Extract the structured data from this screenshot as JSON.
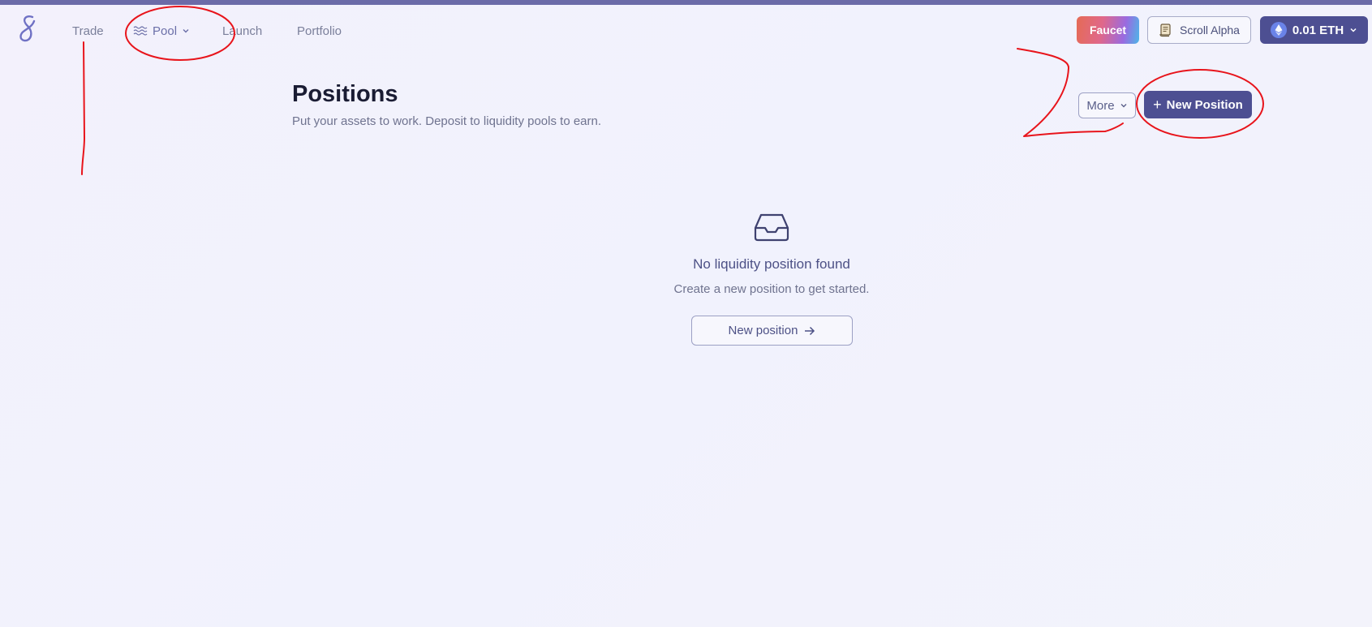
{
  "nav": {
    "items": [
      {
        "label": "Trade"
      },
      {
        "label": "Pool"
      },
      {
        "label": "Launch"
      },
      {
        "label": "Portfolio"
      }
    ]
  },
  "header": {
    "faucet_label": "Faucet",
    "network_label": "Scroll Alpha",
    "wallet_label": "0.01 ETH"
  },
  "page": {
    "title": "Positions",
    "subtitle": "Put your assets to work. Deposit to liquidity pools to earn.",
    "more_label": "More",
    "new_position_label": "New Position"
  },
  "empty_state": {
    "title": "No liquidity position found",
    "text": "Create a new position to get started.",
    "button_label": "New position"
  },
  "colors": {
    "accent": "#4d4f92",
    "annotation": "#e8141b"
  },
  "icons": {
    "logo": "swirl-logo-icon",
    "pool": "waves-icon",
    "network": "scroll-icon",
    "wallet": "ethereum-icon",
    "empty": "inbox-icon"
  }
}
